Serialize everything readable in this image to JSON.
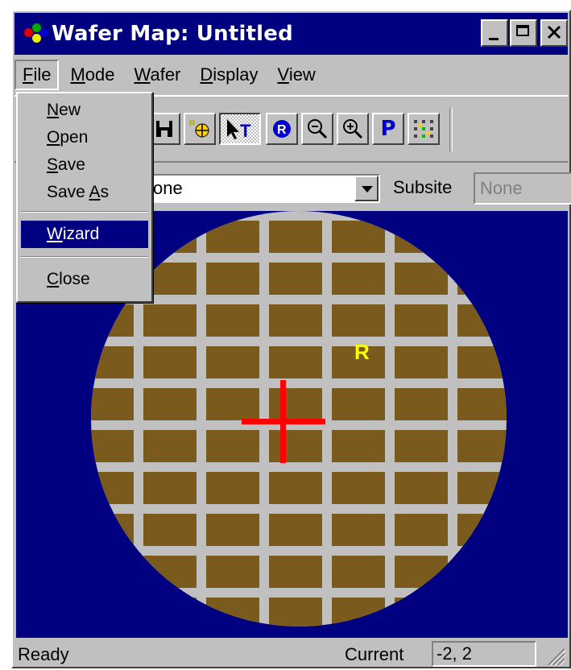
{
  "window": {
    "title": "Wafer Map: Untitled",
    "buttons": [
      "minimize",
      "maximize",
      "close"
    ]
  },
  "menubar": {
    "items": [
      {
        "label": "File",
        "accel": "F",
        "rest": "ile"
      },
      {
        "label": "Mode",
        "accel": "M",
        "rest": "ode"
      },
      {
        "label": "Wafer",
        "accel": "W",
        "rest": "afer"
      },
      {
        "label": "Display",
        "accel": "D",
        "rest": "isplay"
      },
      {
        "label": "View",
        "accel": "V",
        "rest": "iew"
      }
    ]
  },
  "file_menu": {
    "items": [
      {
        "label": "New",
        "accel": "N",
        "rest": "ew",
        "pre": ""
      },
      {
        "label": "Open",
        "accel": "O",
        "rest": "pen",
        "pre": ""
      },
      {
        "label": "Save",
        "accel": "S",
        "rest": "ave",
        "pre": ""
      },
      {
        "label": "Save As",
        "accel": "A",
        "rest": "s",
        "pre": "Save "
      },
      {
        "label": "Wizard",
        "accel": "W",
        "rest": "izard",
        "pre": ""
      },
      {
        "label": "Close",
        "accel": "C",
        "rest": "lose",
        "pre": ""
      }
    ],
    "selected": "Wizard"
  },
  "toolbar": {
    "tools": [
      "save-icon",
      "reference-site-icon",
      "select-text-icon",
      "reference-icon",
      "zoom-out-icon",
      "zoom-in-icon",
      "probe-icon",
      "grid-icon"
    ],
    "probe_label": "P",
    "reference_label": "R",
    "text_tool_label": "T"
  },
  "options": {
    "site_value": "one",
    "subsite_label": "Subsite",
    "subsite_value": "None"
  },
  "map": {
    "reference_marker": "R",
    "colors": {
      "background": "#000080",
      "die": "#7b5a1e",
      "street": "#c0c0c0",
      "crosshair": "#ff0000",
      "marker": "#ffff00"
    }
  },
  "status": {
    "text": "Ready",
    "current_label": "Current",
    "current_value": "-2, 2"
  }
}
